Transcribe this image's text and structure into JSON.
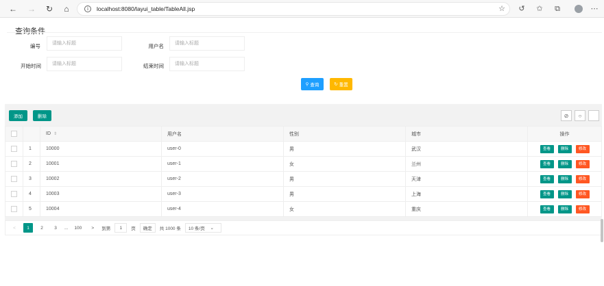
{
  "browser": {
    "url": "localhost:8080/layui_table/TableAll.jsp"
  },
  "query": {
    "title": "查询条件",
    "fields": [
      {
        "label": "编号",
        "placeholder": "请输入标题"
      },
      {
        "label": "用户名",
        "placeholder": "请输入标题"
      },
      {
        "label": "开始时间",
        "placeholder": "请输入标题"
      },
      {
        "label": "结束时间",
        "placeholder": "请输入标题"
      }
    ],
    "search_label": "查询",
    "reset_label": "重置"
  },
  "toolbar": {
    "add_label": "添加",
    "delete_label": "删除"
  },
  "table": {
    "columns": [
      "ID",
      "用户名",
      "性别",
      "城市",
      "操作"
    ],
    "rows": [
      {
        "idx": "1",
        "id": "10000",
        "name": "user-0",
        "sex": "男",
        "city": "武汉"
      },
      {
        "idx": "2",
        "id": "10001",
        "name": "user-1",
        "sex": "女",
        "city": "兰州"
      },
      {
        "idx": "3",
        "id": "10002",
        "name": "user-2",
        "sex": "男",
        "city": "天津"
      },
      {
        "idx": "4",
        "id": "10003",
        "name": "user-3",
        "sex": "男",
        "city": "上海"
      },
      {
        "idx": "5",
        "id": "10004",
        "name": "user-4",
        "sex": "女",
        "city": "重庆"
      }
    ],
    "actions": {
      "view": "查看",
      "delete": "删除",
      "edit": "修改"
    }
  },
  "pager": {
    "prev": "<",
    "pages": [
      "1",
      "2",
      "3"
    ],
    "ellipsis": "...",
    "last": "100",
    "next": ">",
    "goto_label": "到第",
    "goto_value": "1",
    "page_unit": "页",
    "confirm": "确定",
    "total": "共 1000 条",
    "page_size": "10 条/页"
  },
  "colors": {
    "primary": "#009688",
    "search": "#1e9fff",
    "reset": "#ffb800",
    "danger": "#ff5722"
  }
}
